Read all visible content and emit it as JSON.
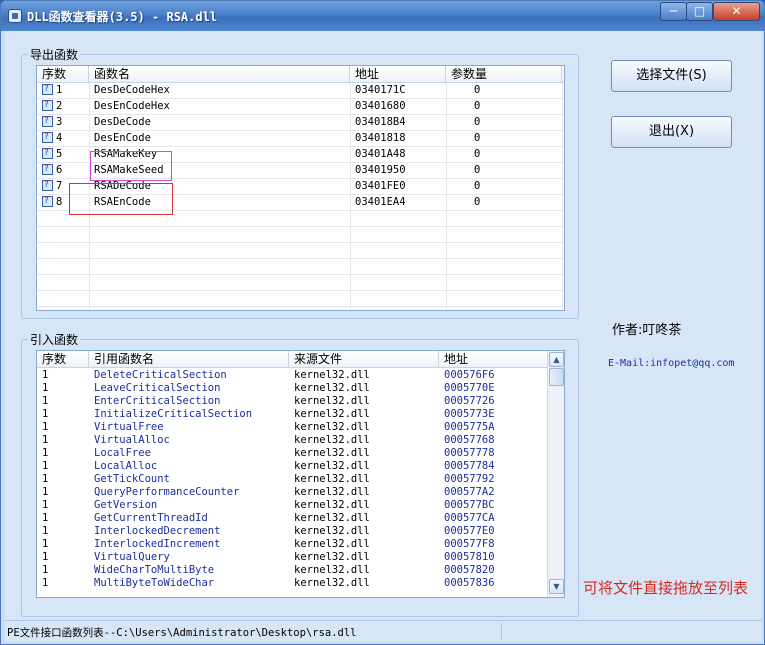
{
  "window": {
    "title": "DLL函数查看器(3.5) - RSA.dll",
    "min_glyph": "─",
    "max_glyph": "□",
    "close_glyph": "✕"
  },
  "exports": {
    "group_title": "导出函数",
    "headers": [
      "序数",
      "函数名",
      "地址",
      "参数量"
    ],
    "rows": [
      {
        "ord": "1",
        "name": "DesDeCodeHex",
        "addr": "0340171C",
        "params": "0"
      },
      {
        "ord": "2",
        "name": "DesEnCodeHex",
        "addr": "03401680",
        "params": "0"
      },
      {
        "ord": "3",
        "name": "DesDeCode",
        "addr": "034018B4",
        "params": "0"
      },
      {
        "ord": "4",
        "name": "DesEnCode",
        "addr": "03401818",
        "params": "0"
      },
      {
        "ord": "5",
        "name": "RSAMakeKey",
        "addr": "03401A48",
        "params": "0"
      },
      {
        "ord": "6",
        "name": "RSAMakeSeed",
        "addr": "03401950",
        "params": "0"
      },
      {
        "ord": "7",
        "name": "RSADeCode",
        "addr": "03401FE0",
        "params": "0"
      },
      {
        "ord": "8",
        "name": "RSAEnCode",
        "addr": "03401EA4",
        "params": "0"
      }
    ]
  },
  "imports": {
    "group_title": "引入函数",
    "headers": [
      "序数",
      "引用函数名",
      "来源文件",
      "地址"
    ],
    "rows": [
      {
        "ord": "1",
        "name": "DeleteCriticalSection",
        "src": "kernel32.dll",
        "addr": "000576F6"
      },
      {
        "ord": "1",
        "name": "LeaveCriticalSection",
        "src": "kernel32.dll",
        "addr": "0005770E"
      },
      {
        "ord": "1",
        "name": "EnterCriticalSection",
        "src": "kernel32.dll",
        "addr": "00057726"
      },
      {
        "ord": "1",
        "name": "InitializeCriticalSection",
        "src": "kernel32.dll",
        "addr": "0005773E"
      },
      {
        "ord": "1",
        "name": "VirtualFree",
        "src": "kernel32.dll",
        "addr": "0005775A"
      },
      {
        "ord": "1",
        "name": "VirtualAlloc",
        "src": "kernel32.dll",
        "addr": "00057768"
      },
      {
        "ord": "1",
        "name": "LocalFree",
        "src": "kernel32.dll",
        "addr": "00057778"
      },
      {
        "ord": "1",
        "name": "LocalAlloc",
        "src": "kernel32.dll",
        "addr": "00057784"
      },
      {
        "ord": "1",
        "name": "GetTickCount",
        "src": "kernel32.dll",
        "addr": "00057792"
      },
      {
        "ord": "1",
        "name": "QueryPerformanceCounter",
        "src": "kernel32.dll",
        "addr": "000577A2"
      },
      {
        "ord": "1",
        "name": "GetVersion",
        "src": "kernel32.dll",
        "addr": "000577BC"
      },
      {
        "ord": "1",
        "name": "GetCurrentThreadId",
        "src": "kernel32.dll",
        "addr": "000577CA"
      },
      {
        "ord": "1",
        "name": "InterlockedDecrement",
        "src": "kernel32.dll",
        "addr": "000577E0"
      },
      {
        "ord": "1",
        "name": "InterlockedIncrement",
        "src": "kernel32.dll",
        "addr": "000577F8"
      },
      {
        "ord": "1",
        "name": "VirtualQuery",
        "src": "kernel32.dll",
        "addr": "00057810"
      },
      {
        "ord": "1",
        "name": "WideCharToMultiByte",
        "src": "kernel32.dll",
        "addr": "00057820"
      },
      {
        "ord": "1",
        "name": "MultiByteToWideChar",
        "src": "kernel32.dll",
        "addr": "00057836"
      }
    ]
  },
  "buttons": {
    "select_file": "选择文件(S)",
    "exit": "退出(X)"
  },
  "author": "作者:叮咚茶",
  "email": "E-Mail:infopet@qq.com",
  "drag_hint": "可将文件直接拖放至列表",
  "status": "PE文件接口函数列表--C:\\Users\\Administrator\\Desktop\\rsa.dll",
  "colors": {
    "title_bar": "#4b80cb",
    "client_bg": "#d6e6f7",
    "link_blue": "#1a2ea0",
    "hint_red": "#d8281e",
    "highlight_pink": "#d04ad0",
    "highlight_red": "#e03030"
  },
  "icons": {
    "app": "app-icon",
    "row": "help-doc-icon",
    "scroll_up": "scroll-up-arrow-icon",
    "scroll_down": "scroll-down-arrow-icon"
  }
}
